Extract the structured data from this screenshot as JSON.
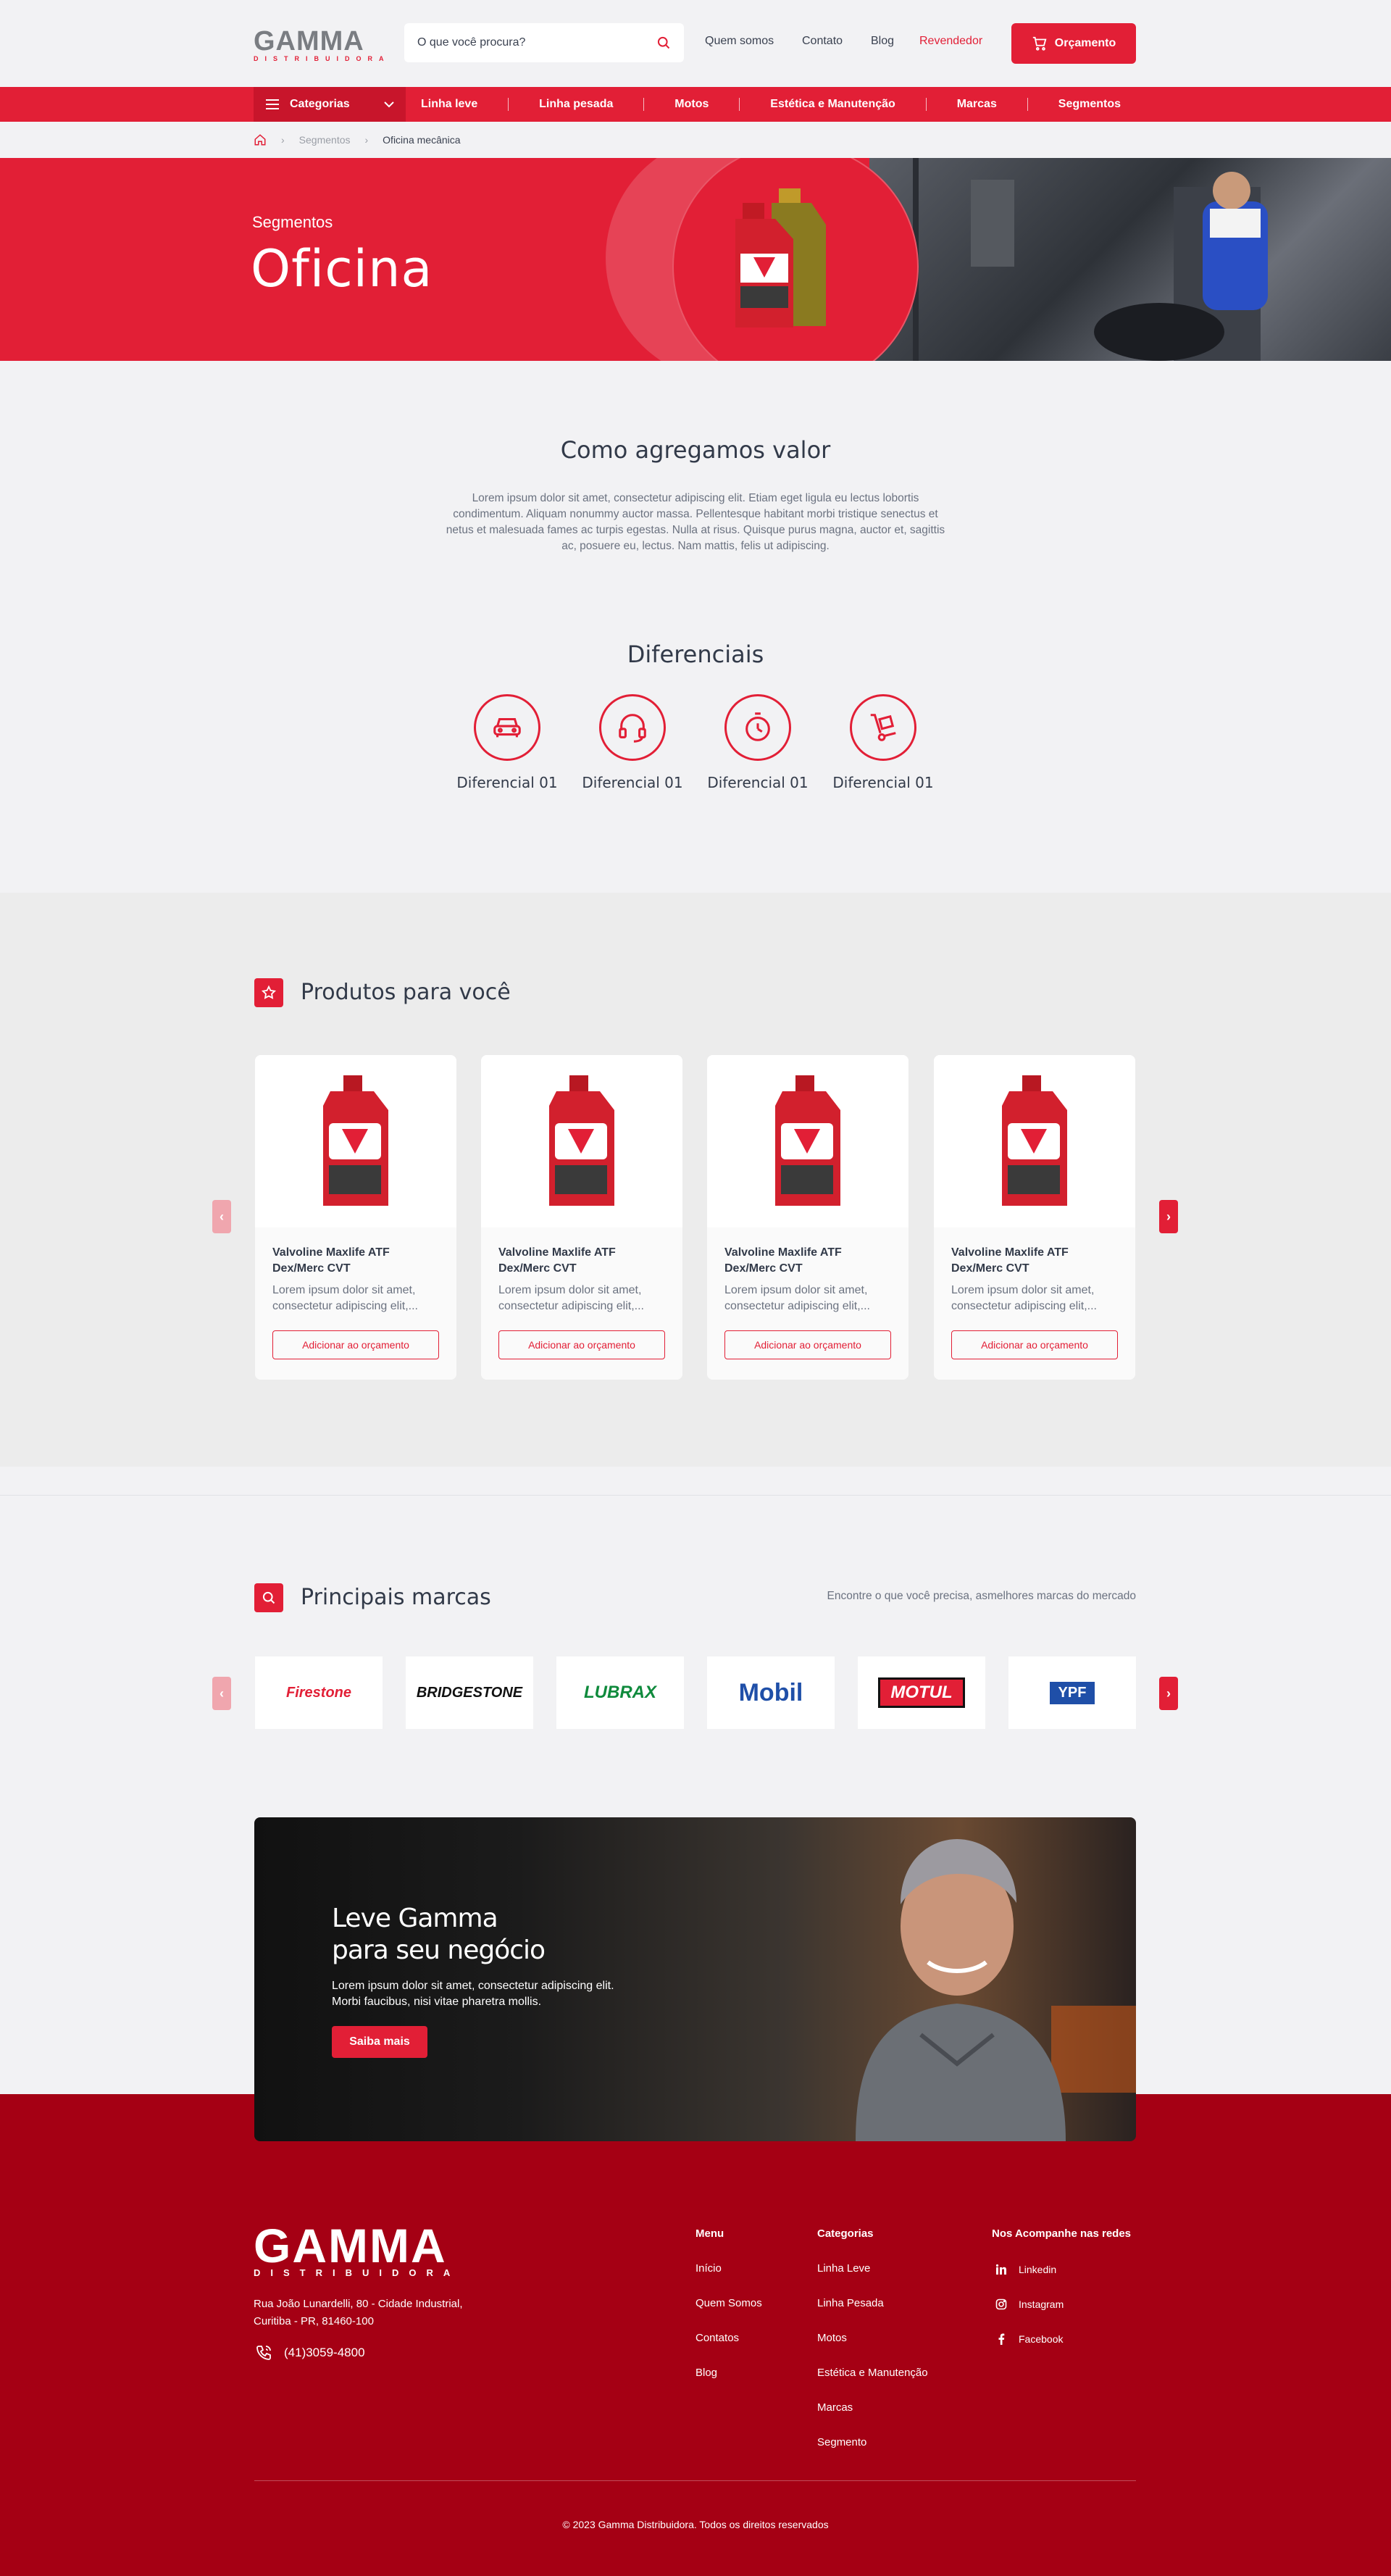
{
  "header": {
    "logo_word": "GAMMA",
    "logo_sub": "DISTRIBUIDORA",
    "search_placeholder": "O que você procura?",
    "nav": [
      "Quem somos",
      "Contato",
      "Blog",
      "Revendedor"
    ],
    "cta": "Orçamento"
  },
  "catbar": {
    "button": "Categorias",
    "links": [
      "Linha leve",
      "Linha pesada",
      "Motos",
      "Estética e Manutenção",
      "Marcas",
      "Segmentos"
    ]
  },
  "breadcrumb": [
    "Segmentos",
    "Oficina mecânica"
  ],
  "hero": {
    "subtitle": "Segmentos",
    "title": "Oficina"
  },
  "value": {
    "title": "Como agregamos valor",
    "text": "Lorem ipsum dolor sit amet, consectetur adipiscing elit. Etiam eget ligula eu lectus lobortis condimentum. Aliquam nonummy auctor massa. Pellentesque habitant morbi tristique senectus et netus et malesuada fames ac turpis egestas. Nulla at risus. Quisque purus magna, auctor et, sagittis ac, posuere eu, lectus. Nam mattis, felis ut adipiscing."
  },
  "diferenciais": {
    "title": "Diferenciais",
    "items": [
      {
        "label": "Diferencial 01",
        "icon": "car-icon"
      },
      {
        "label": "Diferencial 01",
        "icon": "headset-icon"
      },
      {
        "label": "Diferencial 01",
        "icon": "timer-icon"
      },
      {
        "label": "Diferencial 01",
        "icon": "hand-truck-icon"
      }
    ]
  },
  "products": {
    "title": "Produtos para você",
    "items": [
      {
        "name": "Valvoline Maxlife ATF Dex/Merc CVT",
        "desc": "Lorem ipsum dolor sit amet, consectetur adipiscing elit,...",
        "action": "Adicionar ao orçamento"
      },
      {
        "name": "Valvoline Maxlife ATF Dex/Merc CVT",
        "desc": "Lorem ipsum dolor sit amet, consectetur adipiscing elit,...",
        "action": "Adicionar ao orçamento"
      },
      {
        "name": "Valvoline Maxlife ATF Dex/Merc CVT",
        "desc": "Lorem ipsum dolor sit amet, consectetur adipiscing elit,...",
        "action": "Adicionar ao orçamento"
      },
      {
        "name": "Valvoline Maxlife ATF Dex/Merc CVT",
        "desc": "Lorem ipsum dolor sit amet, consectetur adipiscing elit,...",
        "action": "Adicionar ao orçamento"
      }
    ]
  },
  "brands": {
    "title": "Principais marcas",
    "subtitle": "Encontre o que você precisa, asmelhores marcas do mercado",
    "items": [
      "Firestone",
      "BRIDGESTONE",
      "LUBRAX",
      "Mobil",
      "MOTUL",
      "YPF"
    ]
  },
  "banner": {
    "title_line1": "Leve Gamma",
    "title_line2": "para seu negócio",
    "text": "Lorem ipsum dolor sit amet, consectetur adipiscing elit. Morbi faucibus, nisi vitae pharetra mollis.",
    "button": "Saiba mais"
  },
  "footer": {
    "address_line1": "Rua João Lunardelli, 80 - Cidade Industrial,",
    "address_line2": "Curitiba - PR, 81460-100",
    "phone": "(41)3059-4800",
    "menu_title": "Menu",
    "menu": [
      "Início",
      "Quem Somos",
      "Contatos",
      "Blog"
    ],
    "categories_title": "Categorias",
    "categories": [
      "Linha Leve",
      "Linha Pesada",
      "Motos",
      "Estética e Manutenção",
      "Marcas",
      "Segmento"
    ],
    "social_title": "Nos Acompanhe nas redes",
    "social": [
      "Linkedin",
      "Instagram",
      "Facebook"
    ],
    "copyright": "© 2023 Gamma Distribuidora. Todos os direitos reservados"
  },
  "colors": {
    "accent": "#e21f36",
    "footer": "#a50014",
    "text": "#323a49"
  }
}
